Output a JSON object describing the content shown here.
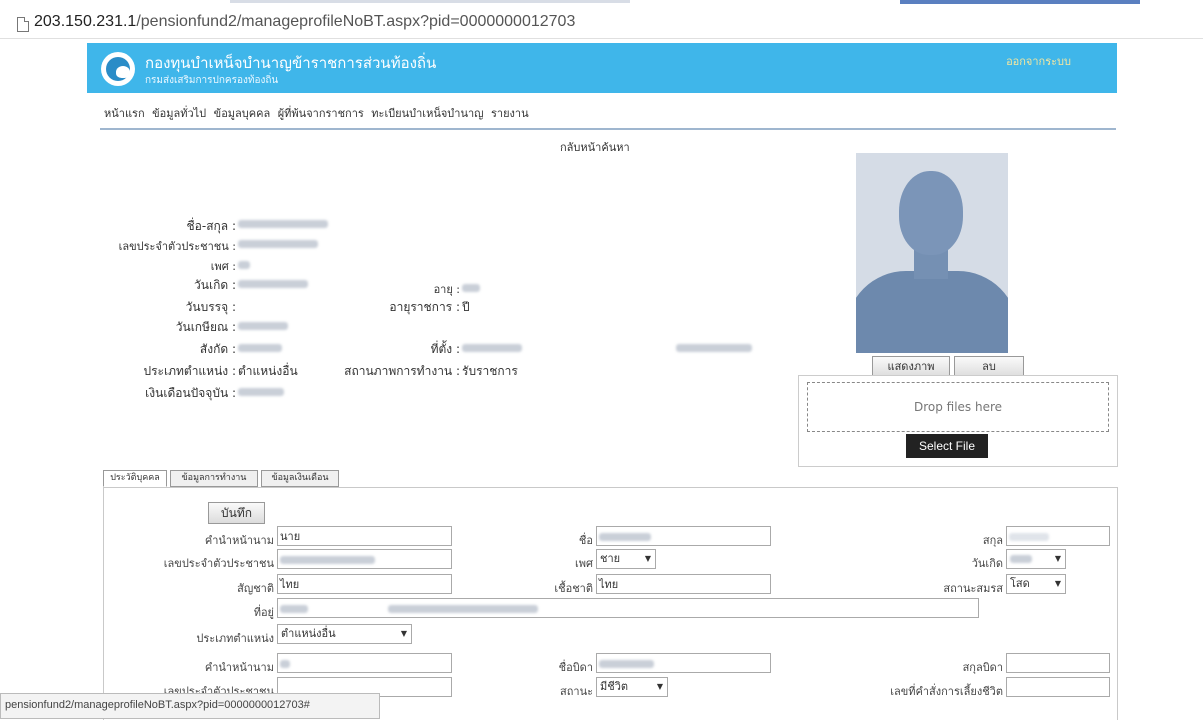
{
  "browser": {
    "url_host": "203.150.231.1",
    "url_path": "/pensionfund2/manageprofileNoBT.aspx?pid=0000000012703"
  },
  "header": {
    "org_title": "กองทุนบำเหน็จบำนาญข้าราชการส่วนท้องถิ่น",
    "org_sub": "กรมส่งเสริมการปกครองท้องถิ่น",
    "logout": "ออกจากระบบ",
    "bg_color": "#3fb6ea"
  },
  "nav": {
    "items": [
      "หน้าแรก",
      "ข้อมูลทั่วไป",
      "ข้อมูลบุคคล",
      "ผู้ที่พ้นจากราชการ",
      "ทะเบียนบำเหน็จบำนาญ",
      "รายงาน"
    ]
  },
  "back_link": "กลับหน้าค้นหา",
  "profile": {
    "name_label": "ชื่อ-สกุล :",
    "id_label": "เลขประจำตัวประชาชน :",
    "sex_label": "เพศ :",
    "birth_label": "วันเกิด :",
    "age_label": "อายุ :",
    "appoint_label": "วันบรรจุ :",
    "service_label": "อายุราชการ :",
    "service_unit": "ปี",
    "retire_label": "วันเกษียณ :",
    "affil_label": "สังกัด :",
    "location_label": "ที่ตั้ง :",
    "postype_label": "ประเภทตำแหน่ง :",
    "postype_value": "ตำแหน่งอื่น",
    "workstatus_label": "สถานภาพการทำงาน :",
    "workstatus_value": "รับราชการ",
    "salary_label": "เงินเดือนปัจจุบัน :"
  },
  "photo": {
    "show_button": "แสดงภาพ",
    "delete_button": "ลบ",
    "drop_text": "Drop files here",
    "select_button": "Select File"
  },
  "tabs": [
    {
      "label": "ประวัติบุคคล",
      "active": true
    },
    {
      "label": "ข้อมูลการทำงาน",
      "active": false
    },
    {
      "label": "ข้อมูลเงินเดือน",
      "active": false
    }
  ],
  "form": {
    "save_button": "บันทึก",
    "title_label": "คำนำหน้านาม",
    "title_value": "นาย",
    "firstname_label": "ชื่อ",
    "lastname_label": "สกุล",
    "idcard_label": "เลขประจำตัวประชาชน",
    "sex_label": "เพศ",
    "sex_value": "ชาย",
    "birth_label": "วันเกิด",
    "nationality_label": "สัญชาติ",
    "nationality_value": "ไทย",
    "race_label": "เชื้อชาติ",
    "race_value": "ไทย",
    "marital_label": "สถานะสมรส",
    "marital_value": "โสด",
    "address_label": "ที่อยู่",
    "postype_label": "ประเภทตำแหน่ง",
    "postype_value": "ตำแหน่งอื่น",
    "father_title_label": "คำนำหน้านาม",
    "father_name_label": "ชื่อบิดา",
    "father_lastname_label": "สกุลบิดา",
    "father_id_label": "เลขประจำตัวประชาชน",
    "father_status_label": "สถานะ",
    "father_status_value": "มีชีวิต",
    "survivor_label": "เลขที่คำสั่งการเลี้ยงชีวิต"
  },
  "status_bar": "pensionfund2/manageprofileNoBT.aspx?pid=0000000012703#"
}
